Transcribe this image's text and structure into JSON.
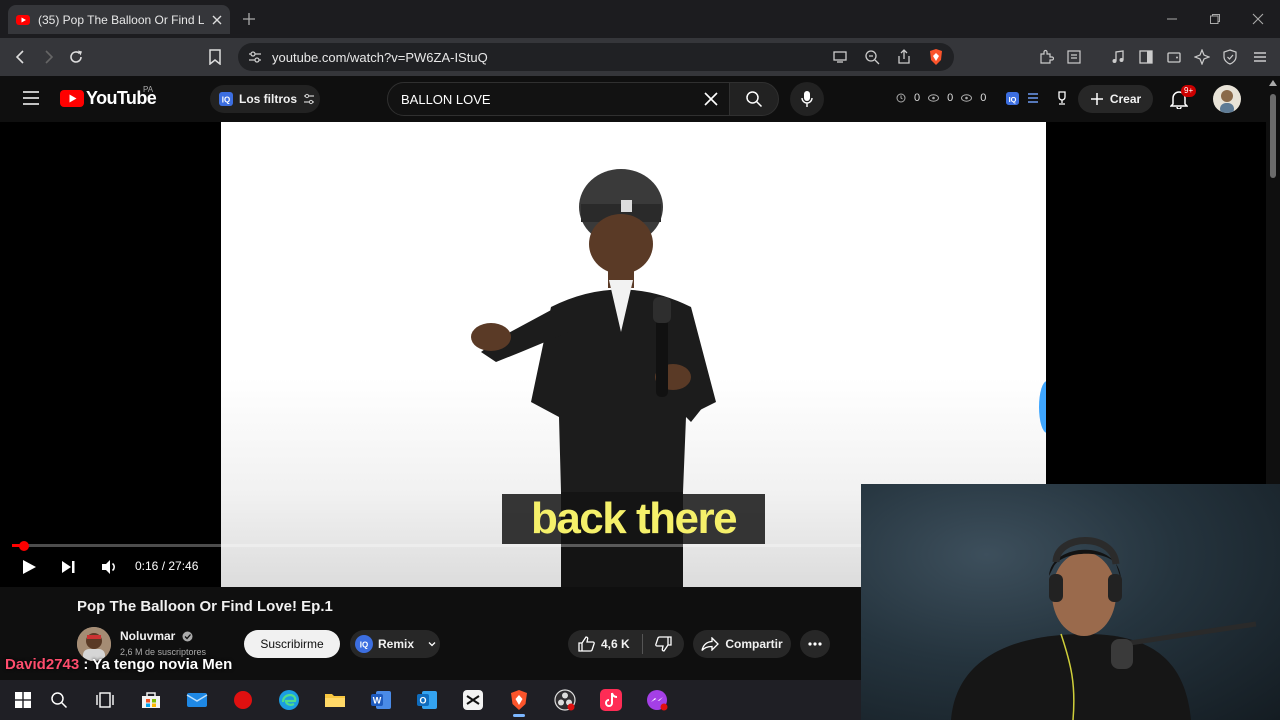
{
  "browser": {
    "tab": {
      "title": "(35) Pop The Balloon Or Find Lo",
      "close_icon": "close-icon",
      "favicon": "youtube-favicon-icon"
    },
    "new_tab_icon": "plus-icon",
    "url": "youtube.com/watch?v=PW6ZA-IStuQ"
  },
  "youtube": {
    "logo_text": "YouTube",
    "region": "PA",
    "filters_label": "Los filtros",
    "search_value": "BALLON LOVE",
    "stats": [
      "0",
      "0",
      "0"
    ],
    "create_label": "Crear",
    "notifications_badge": "9+"
  },
  "player": {
    "caption": "back there",
    "time": "0:16 / 27:46",
    "progress_fraction": 0.0096
  },
  "video": {
    "title": "Pop The Balloon Or Find Love! Ep.1",
    "channel_name": "Noluvmar",
    "subscribers": "2,6 M de suscriptores",
    "subscribe_label": "Suscribirme",
    "remix_label": "Remix",
    "likes": "4,6 K",
    "share_label": "Compartir"
  },
  "chat": {
    "user": "David2743",
    "message": " : Ya tengo novia Men"
  },
  "colors": {
    "youtube_red": "#ff0000",
    "caption_yellow": "#f5f06a",
    "brave_orange": "#fb542b"
  }
}
